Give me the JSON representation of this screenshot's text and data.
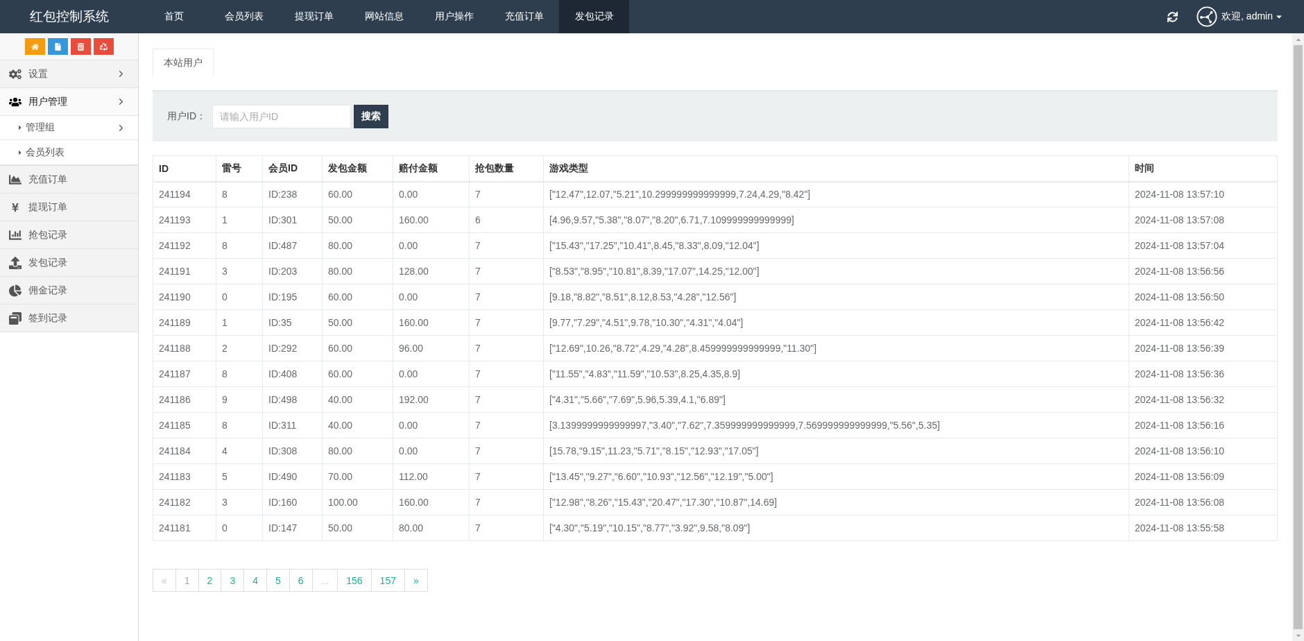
{
  "header": {
    "title": "红包控制系统",
    "nav": [
      {
        "label": "首页",
        "selected": false
      },
      {
        "label": "会员列表",
        "selected": false
      },
      {
        "label": "提现订单",
        "selected": false
      },
      {
        "label": "网站信息",
        "selected": false
      },
      {
        "label": "用户操作",
        "selected": false
      },
      {
        "label": "充值订单",
        "selected": false
      },
      {
        "label": "发包记录",
        "selected": true
      }
    ],
    "greeting": "欢迎, admin"
  },
  "sidebar": {
    "toolbar": [
      {
        "color": "#f39c12"
      },
      {
        "color": "#3498db"
      },
      {
        "color": "#e74c3c"
      },
      {
        "color": "#e74c3c"
      }
    ],
    "items": [
      {
        "label": "设置",
        "kind": "submenu",
        "expanded": false
      },
      {
        "label": "用户管理",
        "kind": "submenu",
        "expanded": true,
        "children": [
          {
            "label": "管理组",
            "kind": "submenu",
            "expanded": false
          },
          {
            "label": "会员列表",
            "kind": "link",
            "expanded": false
          }
        ]
      },
      {
        "label": "充值订单",
        "kind": "link",
        "expanded": false
      },
      {
        "label": "提现订单",
        "kind": "link",
        "expanded": false
      },
      {
        "label": "抢包记录",
        "kind": "link",
        "expanded": false
      },
      {
        "label": "发包记录",
        "kind": "link",
        "expanded": false
      },
      {
        "label": "佣金记录",
        "kind": "link",
        "expanded": false
      },
      {
        "label": "签到记录",
        "kind": "link",
        "expanded": false
      }
    ]
  },
  "tabs": [
    {
      "label": "本站用户",
      "selected": true
    }
  ],
  "search": {
    "label": "用户ID：",
    "placeholder": "请输入用户ID",
    "button": "搜索"
  },
  "table": {
    "columns": [
      "ID",
      "雷号",
      "会员ID",
      "发包金额",
      "赔付金额",
      "抢包数量",
      "游戏类型",
      "时间"
    ],
    "rows": [
      [
        "241194",
        "8",
        "ID:238",
        "60.00",
        "0.00",
        "7",
        "[\"12.47\",12.07,\"5.21\",10.299999999999999,7.24,4.29,\"8.42\"]",
        "2024-11-08 13:57:10"
      ],
      [
        "241193",
        "1",
        "ID:301",
        "50.00",
        "160.00",
        "6",
        "[4.96,9.57,\"5.38\",\"8.07\",\"8.20\",6.71,7.109999999999999]",
        "2024-11-08 13:57:08"
      ],
      [
        "241192",
        "8",
        "ID:487",
        "80.00",
        "0.00",
        "7",
        "[\"15.43\",\"17.25\",\"10.41\",8.45,\"8.33\",8.09,\"12.04\"]",
        "2024-11-08 13:57:04"
      ],
      [
        "241191",
        "3",
        "ID:203",
        "80.00",
        "128.00",
        "7",
        "[\"8.53\",\"8.95\",\"10.81\",8.39,\"17.07\",14.25,\"12.00\"]",
        "2024-11-08 13:56:56"
      ],
      [
        "241190",
        "0",
        "ID:195",
        "60.00",
        "0.00",
        "7",
        "[9.18,\"8.82\",\"8.51\",8.12,8.53,\"4.28\",\"12.56\"]",
        "2024-11-08 13:56:50"
      ],
      [
        "241189",
        "1",
        "ID:35",
        "50.00",
        "160.00",
        "7",
        "[9.77,\"7.29\",\"4.51\",9.78,\"10.30\",\"4.31\",\"4.04\"]",
        "2024-11-08 13:56:42"
      ],
      [
        "241188",
        "2",
        "ID:292",
        "60.00",
        "96.00",
        "7",
        "[\"12.69\",10.26,\"8.72\",4.29,\"4.28\",8.459999999999999,\"11.30\"]",
        "2024-11-08 13:56:39"
      ],
      [
        "241187",
        "8",
        "ID:408",
        "60.00",
        "0.00",
        "7",
        "[\"11.55\",\"4.83\",\"11.59\",\"10.53\",8.25,4.35,8.9]",
        "2024-11-08 13:56:36"
      ],
      [
        "241186",
        "9",
        "ID:498",
        "40.00",
        "192.00",
        "7",
        "[\"4.31\",\"5.66\",\"7.69\",5.96,5.39,4.1,\"6.89\"]",
        "2024-11-08 13:56:32"
      ],
      [
        "241185",
        "8",
        "ID:311",
        "40.00",
        "0.00",
        "7",
        "[3.1399999999999997,\"3.40\",\"7.62\",7.359999999999999,7.569999999999999,\"5.56\",5.35]",
        "2024-11-08 13:56:16"
      ],
      [
        "241184",
        "4",
        "ID:308",
        "80.00",
        "0.00",
        "7",
        "[15.78,\"9.15\",11.23,\"5.71\",\"8.15\",\"12.93\",\"17.05\"]",
        "2024-11-08 13:56:10"
      ],
      [
        "241183",
        "5",
        "ID:490",
        "70.00",
        "112.00",
        "7",
        "[\"13.45\",\"9.27\",\"6.60\",\"10.93\",\"12.56\",\"12.19\",\"5.00\"]",
        "2024-11-08 13:56:09"
      ],
      [
        "241182",
        "3",
        "ID:160",
        "100.00",
        "160.00",
        "7",
        "[\"12.98\",\"8.26\",\"15.43\",\"20.47\",\"17.30\",\"10.87\",14.69]",
        "2024-11-08 13:56:08"
      ],
      [
        "241181",
        "0",
        "ID:147",
        "50.00",
        "80.00",
        "7",
        "[\"4.30\",\"5.19\",\"10.15\",\"8.77\",\"3.92\",9.58,\"8.09\"]",
        "2024-11-08 13:55:58"
      ]
    ]
  },
  "pagination": [
    {
      "label": "«",
      "selected": false,
      "disabled": true
    },
    {
      "label": "1",
      "selected": true,
      "disabled": false
    },
    {
      "label": "2",
      "selected": false,
      "disabled": false
    },
    {
      "label": "3",
      "selected": false,
      "disabled": false
    },
    {
      "label": "4",
      "selected": false,
      "disabled": false
    },
    {
      "label": "5",
      "selected": false,
      "disabled": false
    },
    {
      "label": "6",
      "selected": false,
      "disabled": false
    },
    {
      "label": "...",
      "selected": false,
      "disabled": true
    },
    {
      "label": "156",
      "selected": false,
      "disabled": false
    },
    {
      "label": "157",
      "selected": false,
      "disabled": false
    },
    {
      "label": "»",
      "selected": false,
      "disabled": false
    }
  ]
}
